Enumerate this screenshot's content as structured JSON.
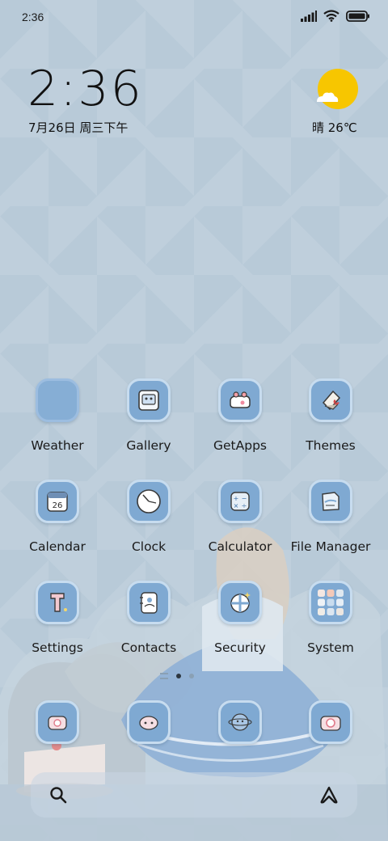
{
  "status": {
    "time": "2:36",
    "icons": [
      "signal-icon",
      "wifi-icon",
      "battery-icon"
    ]
  },
  "clock_widget": {
    "time": "2:36",
    "date": "7月26日 周三下午"
  },
  "weather_widget": {
    "text": "晴 26℃",
    "icon": "sun-cloud-icon",
    "sun_color": "#f7c600"
  },
  "apps": [
    {
      "label": "Weather"
    },
    {
      "label": "Gallery"
    },
    {
      "label": "GetApps"
    },
    {
      "label": "Themes"
    },
    {
      "label": "Calendar",
      "icon_text": "26"
    },
    {
      "label": "Clock"
    },
    {
      "label": "Calculator"
    },
    {
      "label": "File Manager"
    },
    {
      "label": "Settings"
    },
    {
      "label": "Contacts"
    },
    {
      "label": "Security"
    },
    {
      "label": "System"
    }
  ],
  "dock": [
    {
      "icon": "phone-icon"
    },
    {
      "icon": "messages-icon"
    },
    {
      "icon": "browser-icon"
    },
    {
      "icon": "camera-icon"
    }
  ],
  "page_indicator": {
    "pages": 2,
    "current": 1
  },
  "search_bar": {
    "left_icon": "search-icon",
    "right_icon": "assistant-icon"
  },
  "colors": {
    "background": "#b8cad8",
    "icon_fill": "#7fa9d2",
    "icon_border": "#c7dcef",
    "text": "#1a1a1a"
  }
}
